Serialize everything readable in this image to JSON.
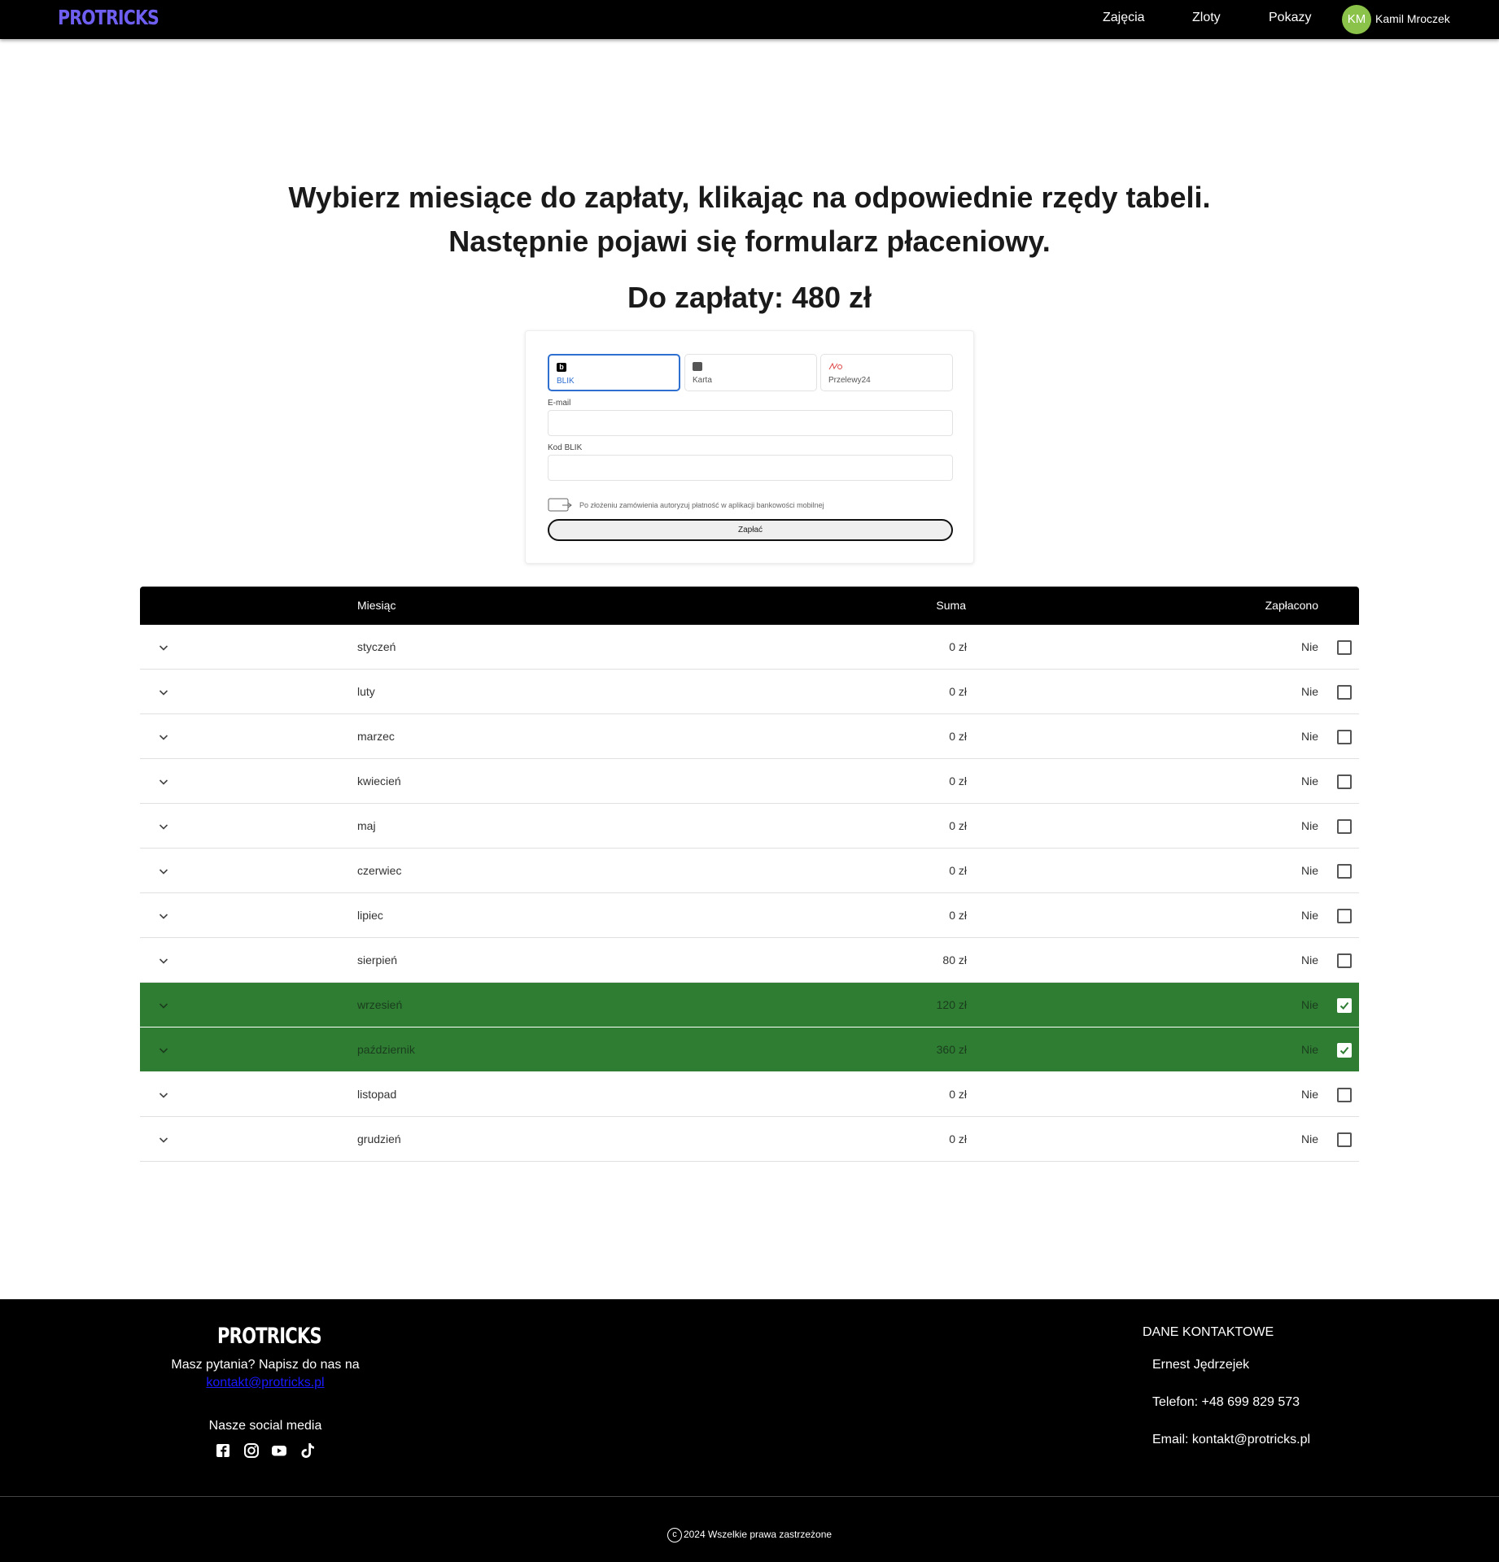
{
  "nav": {
    "brand": "PROTRICKS",
    "links": [
      "Zajęcia",
      "Zloty",
      "Pokazy"
    ],
    "user_initials": "KM",
    "user_name": "Kamil Mroczek"
  },
  "heading": {
    "line1": "Wybierz miesiące do zapłaty, klikając na odpowiednie rzędy tabeli.",
    "line2": "Następnie pojawi się formularz płaceniowy.",
    "amount": "Do zapłaty: 480 zł"
  },
  "payment": {
    "methods": [
      "BLIK",
      "Karta",
      "Przelewy24"
    ],
    "selected_method": "BLIK",
    "email_label": "E-mail",
    "email_value": "",
    "blik_label": "Kod BLIK",
    "blik_value": "",
    "note": "Po złożeniu zamówienia autoryzuj płatność w aplikacji bankowości mobilnej",
    "pay_label": "Zapłać",
    "icons": [
      "blik-icon",
      "card-icon",
      "przelewy24-icon",
      "mobile-payment-icon"
    ]
  },
  "table": {
    "headers": {
      "month": "Miesiąc",
      "sum": "Suma",
      "paid": "Zapłacono"
    },
    "rows": [
      {
        "month": "styczeń",
        "sum": "0 zł",
        "paid": "Nie",
        "selected": false
      },
      {
        "month": "luty",
        "sum": "0 zł",
        "paid": "Nie",
        "selected": false
      },
      {
        "month": "marzec",
        "sum": "0 zł",
        "paid": "Nie",
        "selected": false
      },
      {
        "month": "kwiecień",
        "sum": "0 zł",
        "paid": "Nie",
        "selected": false
      },
      {
        "month": "maj",
        "sum": "0 zł",
        "paid": "Nie",
        "selected": false
      },
      {
        "month": "czerwiec",
        "sum": "0 zł",
        "paid": "Nie",
        "selected": false
      },
      {
        "month": "lipiec",
        "sum": "0 zł",
        "paid": "Nie",
        "selected": false
      },
      {
        "month": "sierpień",
        "sum": "80 zł",
        "paid": "Nie",
        "selected": false
      },
      {
        "month": "wrzesień",
        "sum": "120 zł",
        "paid": "Nie",
        "selected": true
      },
      {
        "month": "październik",
        "sum": "360 zł",
        "paid": "Nie",
        "selected": true
      },
      {
        "month": "listopad",
        "sum": "0 zł",
        "paid": "Nie",
        "selected": false
      },
      {
        "month": "grudzień",
        "sum": "0 zł",
        "paid": "Nie",
        "selected": false
      }
    ],
    "selected_color": "#2e7d32"
  },
  "footer": {
    "brand": "PROTRICKS",
    "question": "Masz pytania? Napisz do nas na",
    "email_link": "kontakt@protricks.pl",
    "social_title": "Nasze social media",
    "social_icons": [
      "facebook-icon",
      "instagram-icon",
      "youtube-icon",
      "tiktok-icon"
    ],
    "contact_title": "DANE KONTAKTOWE",
    "contact_name": "Ernest Jędrzejek",
    "contact_phone": "Telefon: +48 699 829 573",
    "contact_email": "Email: kontakt@protricks.pl",
    "copyright": "2024 Wszelkie prawa zastrzeżone"
  },
  "colors": {
    "brand": "#6f5ff0",
    "accent": "#2f6fd0",
    "avatar": "#8bc34a",
    "link": "#1a1aff"
  }
}
